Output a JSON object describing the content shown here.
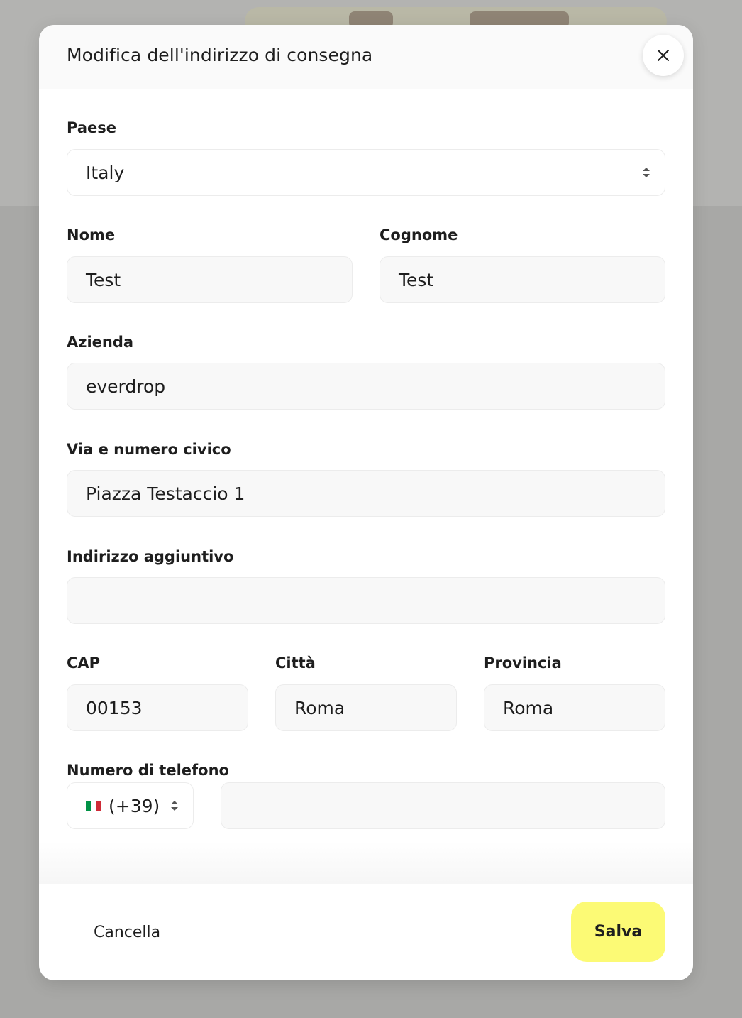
{
  "modal": {
    "title": "Modifica dell'indirizzo di consegna",
    "close_icon": "close-icon"
  },
  "form": {
    "country": {
      "label": "Paese",
      "value": "Italy"
    },
    "first_name": {
      "label": "Nome",
      "value": "Test"
    },
    "last_name": {
      "label": "Cognome",
      "value": "Test"
    },
    "company": {
      "label": "Azienda",
      "value": "everdrop"
    },
    "street": {
      "label": "Via e numero civico",
      "value": "Piazza Testaccio 1"
    },
    "address_extra": {
      "label": "Indirizzo aggiuntivo",
      "value": ""
    },
    "zip": {
      "label": "CAP",
      "value": "00153"
    },
    "city": {
      "label": "Città",
      "value": "Roma"
    },
    "province": {
      "label": "Provincia",
      "value": "Roma"
    },
    "phone": {
      "label": "Numero di telefono",
      "prefix": "(+39)",
      "flag_icon": "italy-flag-icon",
      "value": ""
    }
  },
  "footer": {
    "cancel_label": "Cancella",
    "save_label": "Salva"
  },
  "colors": {
    "save_button": "#fcfa75",
    "flag_green": "#009246",
    "flag_white": "#ffffff",
    "flag_red": "#ce2b37"
  }
}
